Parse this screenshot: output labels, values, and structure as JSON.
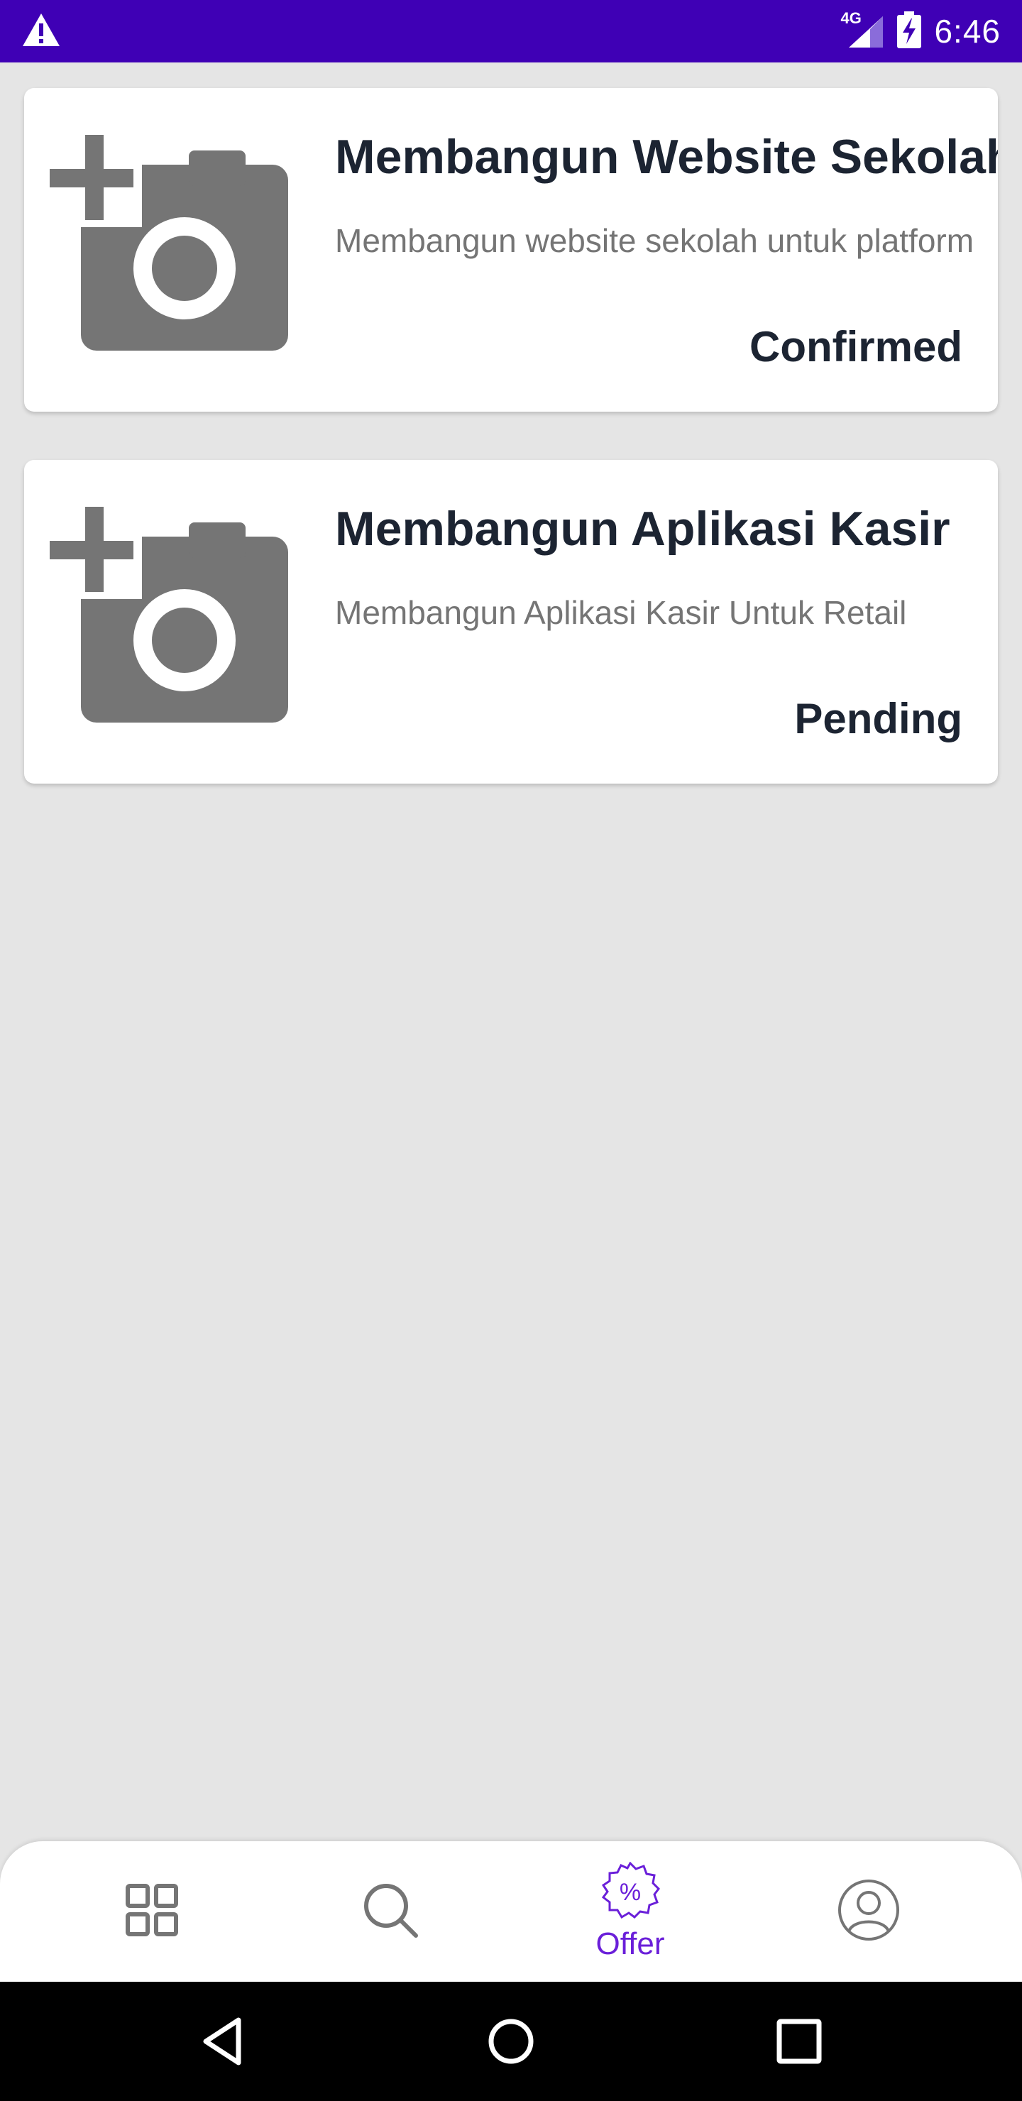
{
  "status_bar": {
    "time": "6:46",
    "network": "4G",
    "icons": [
      "warning-icon",
      "signal-icon",
      "battery-charging-icon"
    ]
  },
  "offers": [
    {
      "title": "Membangun Website Sekolah",
      "description": "Membangun website sekolah untuk platform",
      "status": "Confirmed",
      "image_icon": "add-photo-icon"
    },
    {
      "title": "Membangun Aplikasi Kasir",
      "description": "Membangun Aplikasi Kasir Untuk Retail",
      "status": "Pending",
      "image_icon": "add-photo-icon"
    }
  ],
  "bottom_nav": {
    "items": [
      {
        "icon": "grid-icon",
        "label": ""
      },
      {
        "icon": "search-icon",
        "label": ""
      },
      {
        "icon": "offer-badge-icon",
        "label": "Offer",
        "active": true
      },
      {
        "icon": "profile-icon",
        "label": ""
      }
    ],
    "active_color": "#6a1fd9"
  },
  "colors": {
    "status_bar": "#3f00b5",
    "background": "#e5e5e5",
    "title_text": "#1c2432",
    "icon_gray": "#757575"
  }
}
